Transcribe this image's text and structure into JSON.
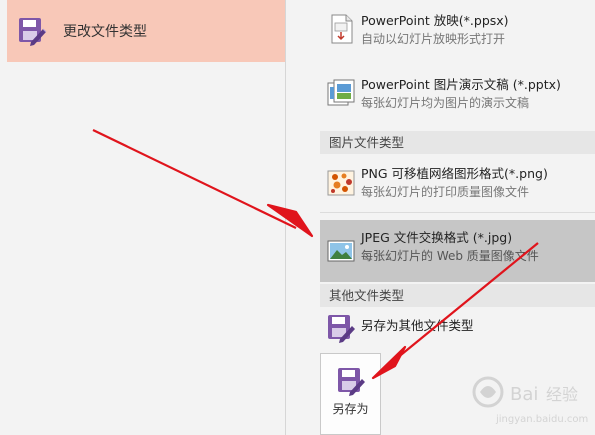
{
  "left_pane": {
    "change_file_type": {
      "label": "更改文件类型",
      "icon": "floppy-save-icon"
    }
  },
  "right_pane": {
    "items": [
      {
        "title": "PowerPoint 放映(*.ppsx)",
        "desc": "自动以幻灯片放映形式打开",
        "icon": "slideshow-file-icon"
      },
      {
        "title": "PowerPoint 图片演示文稿 (*.pptx)",
        "desc": "每张幻灯片均为图片的演示文稿",
        "icon": "picture-presentation-icon"
      }
    ],
    "image_section": {
      "header": "图片文件类型",
      "items": [
        {
          "title": "PNG 可移植网络图形格式(*.png)",
          "desc": "每张幻灯片的打印质量图像文件",
          "icon": "png-image-icon"
        },
        {
          "title": "JPEG 文件交换格式 (*.jpg)",
          "desc": "每张幻灯片的 Web 质量图像文件",
          "icon": "jpeg-image-icon",
          "selected": true
        }
      ]
    },
    "other_section": {
      "header": "其他文件类型",
      "items": [
        {
          "title": "另存为其他文件类型",
          "icon": "floppy-save-icon"
        }
      ]
    }
  },
  "save_as_button": {
    "label": "另存为",
    "icon": "floppy-save-icon"
  },
  "colors": {
    "accent_highlight": "#f8c8b8",
    "selected_row": "#c6c6c6",
    "annotation_arrow": "#e0141c",
    "floppy": "#7e57a8"
  }
}
